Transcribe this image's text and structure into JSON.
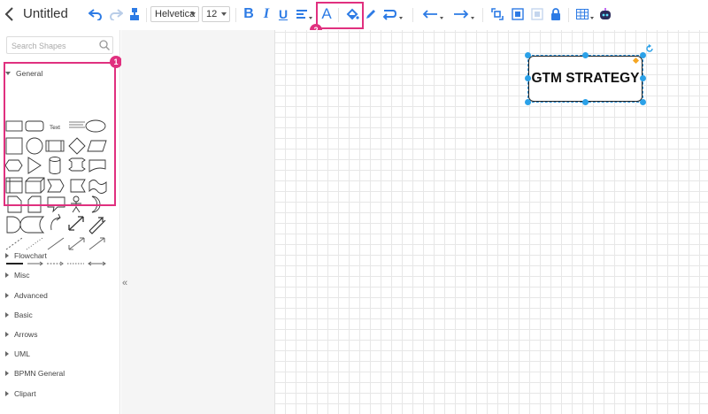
{
  "app": {
    "doc_title": "Untitled"
  },
  "toolbar": {
    "font_family": "Helvetica",
    "font_size": "12",
    "bold_label": "B",
    "italic_label": "I",
    "underline_label": "U",
    "font_color_label": "A",
    "accent_color": "#2d7be5",
    "highlight_color": "#e0307f"
  },
  "sidebar": {
    "search_placeholder": "Search Shapes",
    "general_label": "General",
    "text_shape_label": "Text",
    "sections": [
      {
        "label": "Flowchart"
      },
      {
        "label": "Misc"
      },
      {
        "label": "Advanced"
      },
      {
        "label": "Basic"
      },
      {
        "label": "Arrows"
      },
      {
        "label": "UML"
      },
      {
        "label": "BPMN General"
      },
      {
        "label": "Clipart"
      }
    ],
    "collapse_label": "«"
  },
  "annotations": {
    "badge_1": "1",
    "badge_2": "2"
  },
  "canvas": {
    "selected_shape_text": "GTM STRATEGY",
    "selection_color": "#2ba1e8"
  }
}
